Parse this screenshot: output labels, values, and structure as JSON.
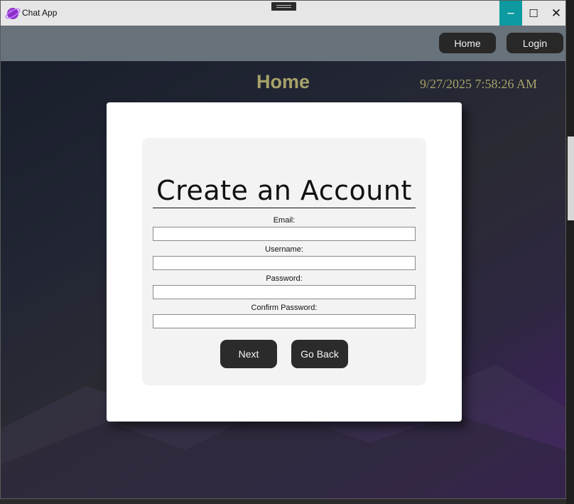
{
  "window": {
    "title": "Chat App",
    "icon": "planet-icon",
    "controls": {
      "minimize": "─",
      "maximize": "☐",
      "close": "✕"
    }
  },
  "navbar": {
    "home_label": "Home",
    "login_label": "Login"
  },
  "page": {
    "heading": "Home",
    "clock": "9/27/2025 7:58:26 AM"
  },
  "form": {
    "title": "Create an Account",
    "fields": [
      {
        "label": "Email:",
        "value": ""
      },
      {
        "label": "Username:",
        "value": ""
      },
      {
        "label": "Password:",
        "value": ""
      },
      {
        "label": "Confirm Password:",
        "value": ""
      }
    ],
    "next_label": "Next",
    "back_label": "Go Back"
  },
  "colors": {
    "accent": "#0d9aa0",
    "heading": "#a7a26a",
    "navbar": "#68727b",
    "button": "#2b2b2b"
  }
}
